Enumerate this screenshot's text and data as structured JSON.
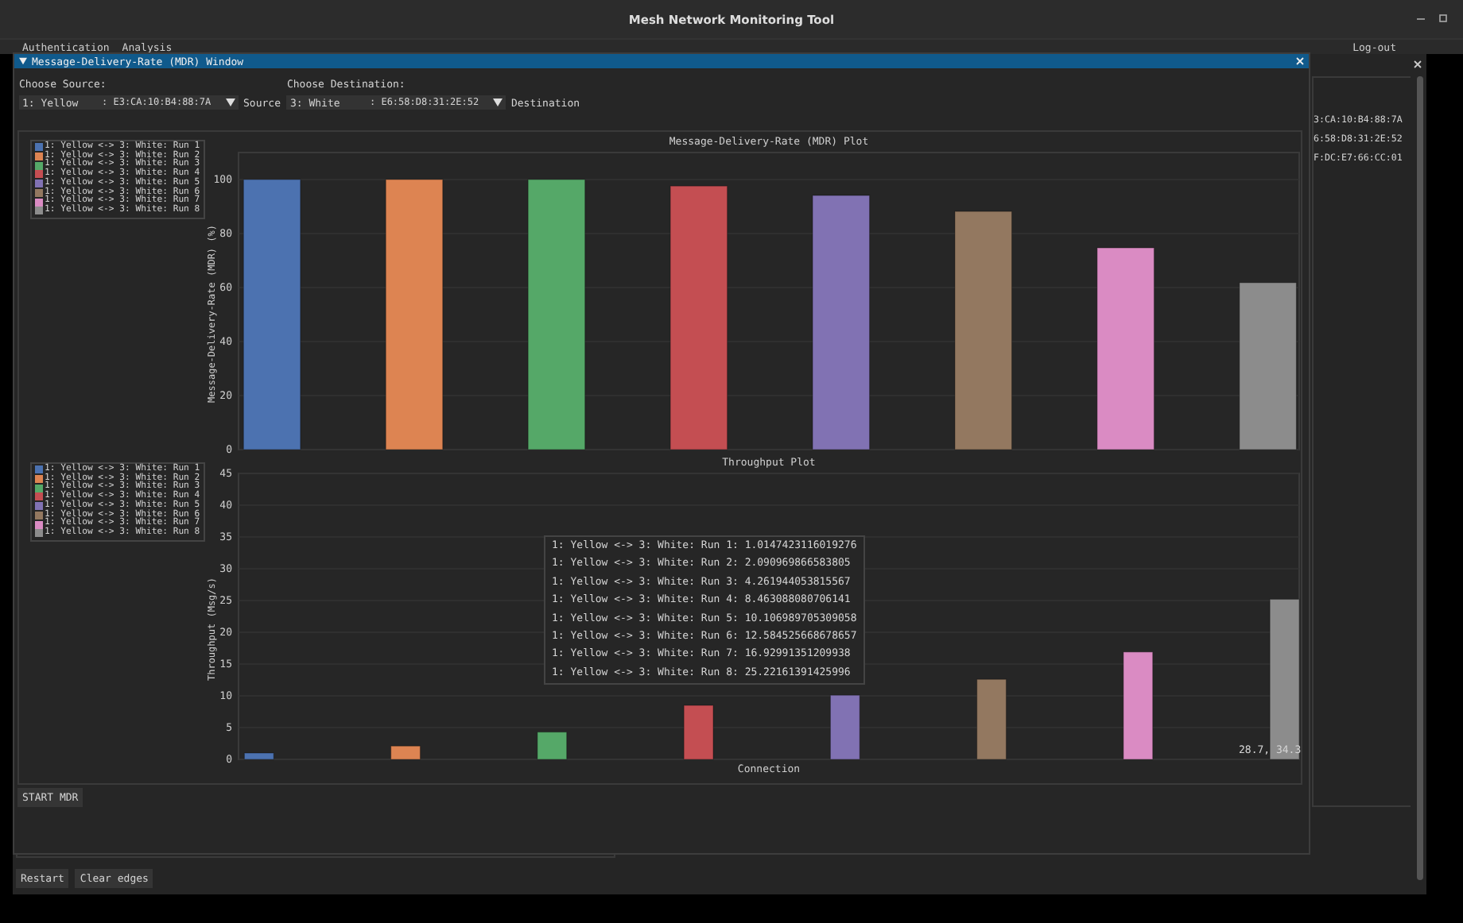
{
  "window": {
    "title": "Mesh Network Monitoring Tool"
  },
  "menu": [
    {
      "label": "Authentication"
    },
    {
      "label": "Analysis"
    }
  ],
  "logout": "Log-out",
  "background_panel": {
    "addresses": [
      "3:CA:10:B4:88:7A",
      "6:58:D8:31:2E:52",
      "F:DC:E7:66:CC:01"
    ]
  },
  "mdr_window": {
    "title": "Message-Delivery-Rate (MDR) Window",
    "source": {
      "label": "Choose Source:",
      "value": "1: Yellow",
      "address": ": E3:CA:10:B4:88:7A",
      "caption": "Source"
    },
    "destination": {
      "label": "Choose Destination:",
      "value": "3: White",
      "address": ": E6:58:D8:31:2E:52",
      "caption": "Destination"
    },
    "plots": [
      {
        "chart_data": {
          "type": "bar",
          "title": "Message-Delivery-Rate (MDR) Plot",
          "ylabel": "Message-Delivery-Rate (MDR) (%)",
          "grid": true,
          "legend": true,
          "ylim": [
            0,
            110
          ],
          "yticks": [
            0,
            20,
            40,
            60,
            80,
            100
          ],
          "series": [
            {
              "name": "1: Yellow <-> 3: White: Run 1",
              "color": "#4c72b0",
              "values": [
                100
              ]
            },
            {
              "name": "1: Yellow <-> 3: White: Run 2",
              "color": "#dd8452",
              "values": [
                100
              ]
            },
            {
              "name": "1: Yellow <-> 3: White: Run 3",
              "color": "#55a868",
              "values": [
                100
              ]
            },
            {
              "name": "1: Yellow <-> 3: White: Run 4",
              "color": "#c44e52",
              "values": [
                97.6
              ]
            },
            {
              "name": "1: Yellow <-> 3: White: Run 5",
              "color": "#8172b3",
              "values": [
                94.1
              ]
            },
            {
              "name": "1: Yellow <-> 3: White: Run 6",
              "color": "#937860",
              "values": [
                88.2
              ]
            },
            {
              "name": "1: Yellow <-> 3: White: Run 7",
              "color": "#da8bc3",
              "values": [
                74.7
              ]
            },
            {
              "name": "1: Yellow <-> 3: White: Run 8",
              "color": "#8c8c8c",
              "values": [
                61.8
              ]
            }
          ]
        }
      },
      {
        "chart_data": {
          "type": "bar",
          "title": "Throughput Plot",
          "xlabel": "Connection",
          "ylabel": "Throughput (Msg/s)",
          "grid": true,
          "legend": true,
          "ylim": [
            0,
            45
          ],
          "yticks": [
            0,
            5,
            10,
            15,
            20,
            25,
            30,
            35,
            40,
            45
          ],
          "series": [
            {
              "name": "1: Yellow <-> 3: White: Run 1",
              "color": "#4c72b0",
              "values": [
                1
              ]
            },
            {
              "name": "1: Yellow <-> 3: White: Run 2",
              "color": "#dd8452",
              "values": [
                2.1
              ]
            },
            {
              "name": "1: Yellow <-> 3: White: Run 3",
              "color": "#55a868",
              "values": [
                4.3
              ]
            },
            {
              "name": "1: Yellow <-> 3: White: Run 4",
              "color": "#c44e52",
              "values": [
                8.5
              ]
            },
            {
              "name": "1: Yellow <-> 3: White: Run 5",
              "color": "#8172b3",
              "values": [
                10.1
              ]
            },
            {
              "name": "1: Yellow <-> 3: White: Run 6",
              "color": "#937860",
              "values": [
                12.6
              ]
            },
            {
              "name": "1: Yellow <-> 3: White: Run 7",
              "color": "#da8bc3",
              "values": [
                16.9
              ]
            },
            {
              "name": "1: Yellow <-> 3: White: Run 8",
              "color": "#8c8c8c",
              "values": [
                25.2
              ]
            }
          ]
        },
        "tooltip": [
          "1: Yellow <-> 3: White: Run 1: 1.0147423116019276",
          "1: Yellow <-> 3: White: Run 2: 2.090969866583805",
          "1: Yellow <-> 3: White: Run 3: 4.261944053815567",
          "1: Yellow <-> 3: White: Run 4: 8.463088080706141",
          "1: Yellow <-> 3: White: Run 5: 10.106989705309058",
          "1: Yellow <-> 3: White: Run 6: 12.584525668678657",
          "1: Yellow <-> 3: White: Run 7: 16.92991351209938",
          "1: Yellow <-> 3: White: Run 8: 25.22161391425996"
        ],
        "cursor_readout": "28.7, 34.3"
      }
    ],
    "start_button": "START MDR"
  },
  "buttons": [
    "Restart",
    "Clear edges"
  ]
}
